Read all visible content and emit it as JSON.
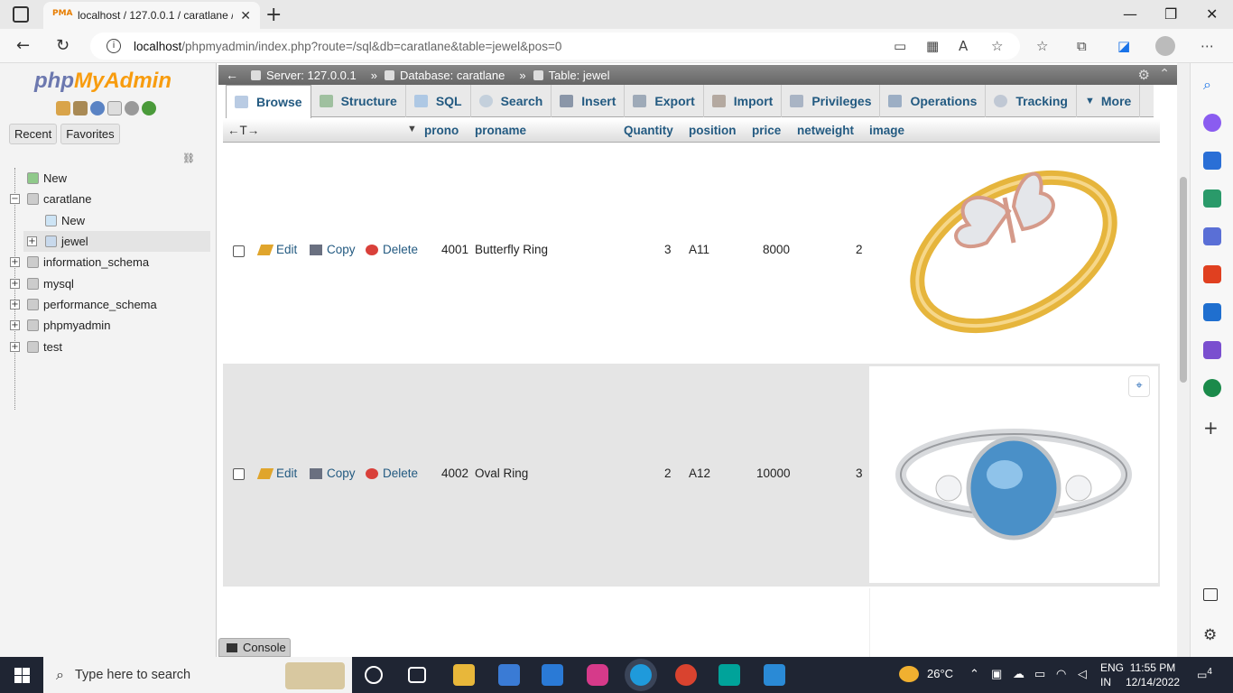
{
  "browser": {
    "tab_title": "localhost / 127.0.0.1 / caratlane /",
    "favicon_text": "PMA",
    "url_host": "localhost",
    "url_path": "/phpmyadmin/index.php?route=/sql&db=caratlane&table=jewel&pos=0"
  },
  "nav": {
    "logo_php": "php",
    "logo_myadmin": "MyAdmin",
    "tabs": [
      "Recent",
      "Favorites"
    ],
    "tree": {
      "new_root": "New",
      "db_caratlane": "caratlane",
      "new_table": "New",
      "table_jewel": "jewel",
      "db_info": "information_schema",
      "db_mysql": "mysql",
      "db_perf": "performance_schema",
      "db_pma": "phpmyadmin",
      "db_test": "test"
    }
  },
  "breadcrumb": {
    "server": "Server: 127.0.0.1",
    "database": "Database: caratlane",
    "table": "Table: jewel",
    "sep": "»"
  },
  "menu": [
    "Browse",
    "Structure",
    "SQL",
    "Search",
    "Insert",
    "Export",
    "Import",
    "Privileges",
    "Operations",
    "Tracking",
    "More"
  ],
  "table": {
    "sort_arrows": "←T→",
    "columns": [
      "prono",
      "proname",
      "Quantity",
      "position",
      "price",
      "netweight",
      "image"
    ],
    "actions": {
      "edit": "Edit",
      "copy": "Copy",
      "delete": "Delete"
    },
    "rows": [
      {
        "prono": "4001",
        "proname": "Butterfly Ring",
        "quantity": "3",
        "position": "A11",
        "price": "8000",
        "netweight": "2"
      },
      {
        "prono": "4002",
        "proname": "Oval Ring",
        "quantity": "2",
        "position": "A12",
        "price": "10000",
        "netweight": "3"
      }
    ]
  },
  "console_label": "Console",
  "taskbar": {
    "search_placeholder": "Type here to search",
    "temperature": "26°C",
    "lang_1": "ENG",
    "lang_2": "IN",
    "time": "11:55 PM",
    "date": "12/14/2022",
    "notification_count": "4"
  }
}
